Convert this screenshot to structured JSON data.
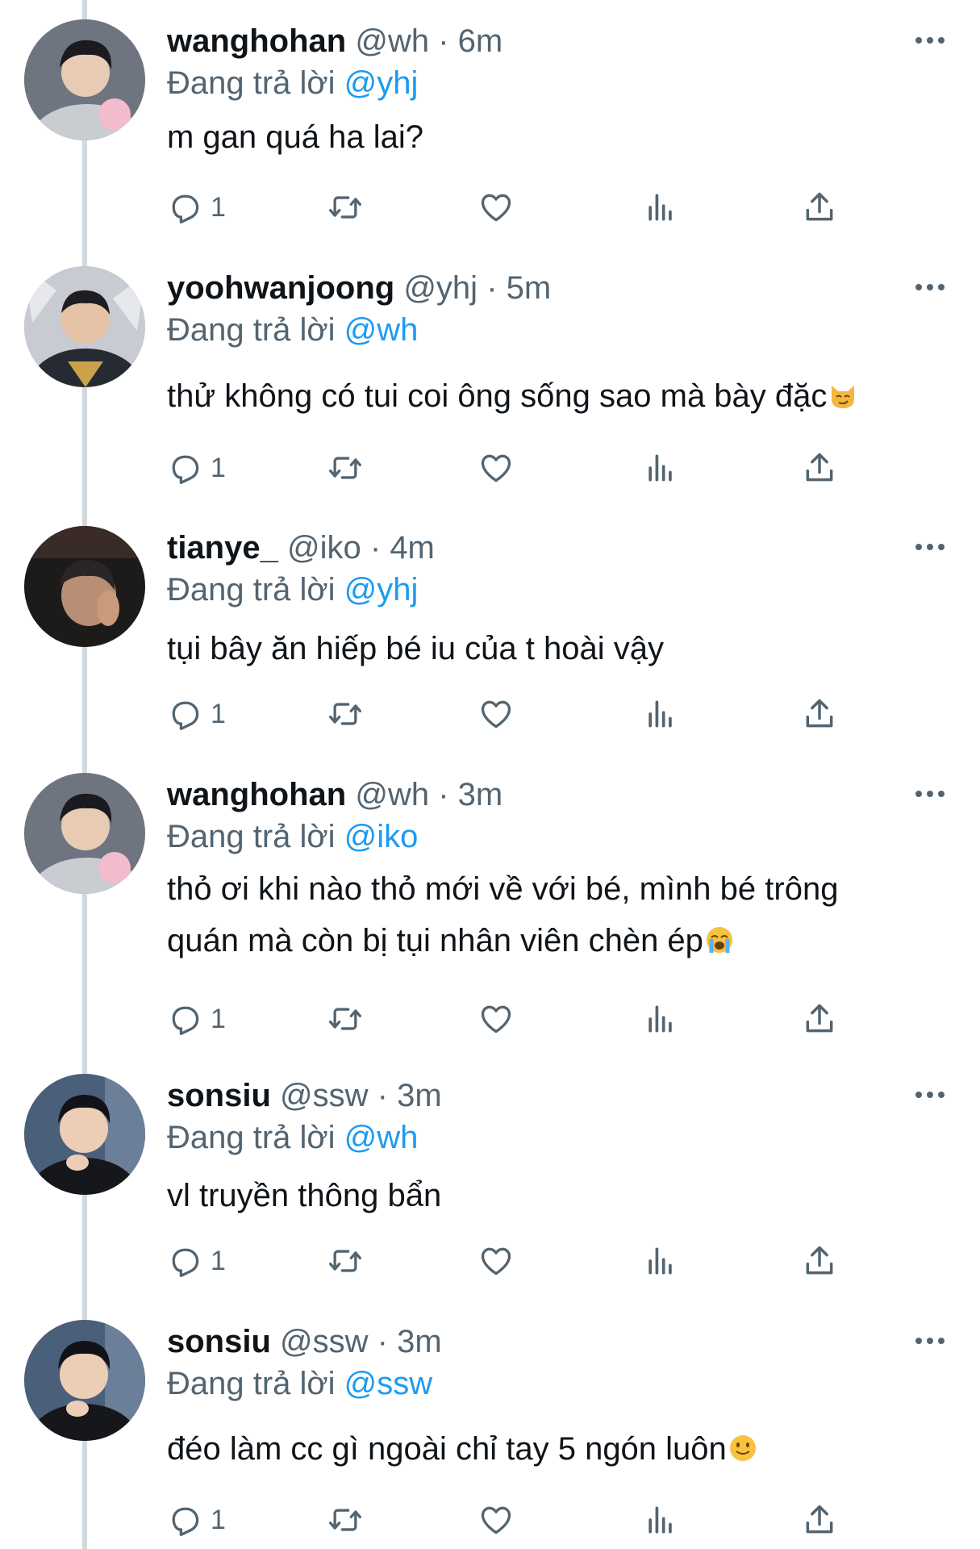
{
  "replying_prefix": "Đang trả lời",
  "separator": "·",
  "colors": {
    "mention": "#1d9bf0",
    "muted": "#536471",
    "text": "#0f1419",
    "thread_line": "#cfd9de"
  },
  "icons": {
    "reply": "reply-icon",
    "retweet": "retweet-icon",
    "like": "heart-icon",
    "analytics": "analytics-icon",
    "share": "share-icon",
    "more": "more-icon"
  },
  "tweets": [
    {
      "name": "wanghohan",
      "handle": "@wh",
      "time": "6m",
      "reply_to": "@yhj",
      "text": "m gan quá ha lai?",
      "emoji": "",
      "reply_count": "1"
    },
    {
      "name": "yoohwanjoong",
      "handle": "@yhj",
      "time": "5m",
      "reply_to": "@wh",
      "text": "thử không có tui coi ông sống sao mà bày đặc",
      "emoji": "smirking-cat",
      "reply_count": "1"
    },
    {
      "name": "tianye_",
      "handle": "@iko",
      "time": "4m",
      "reply_to": "@yhj",
      "text": "tụi bây ăn hiếp bé iu của t hoài vậy",
      "emoji": "",
      "reply_count": "1"
    },
    {
      "name": "wanghohan",
      "handle": "@wh",
      "time": "3m",
      "reply_to": "@iko",
      "text_line1": "thỏ ơi khi nào thỏ mới về với bé, mình bé trông",
      "text_line2": "quán mà còn bị tụi nhân viên chèn ép",
      "emoji": "loudly-crying",
      "reply_count": "1"
    },
    {
      "name": "sonsiu",
      "handle": "@ssw",
      "time": "3m",
      "reply_to": "@wh",
      "text": "vl truyền thông bẩn",
      "emoji": "",
      "reply_count": "1"
    },
    {
      "name": "sonsiu",
      "handle": "@ssw",
      "time": "3m",
      "reply_to": "@ssw",
      "text": "đéo làm cc gì ngoài chỉ tay 5 ngón luôn",
      "emoji": "slightly-smiling",
      "reply_count": "1"
    }
  ]
}
